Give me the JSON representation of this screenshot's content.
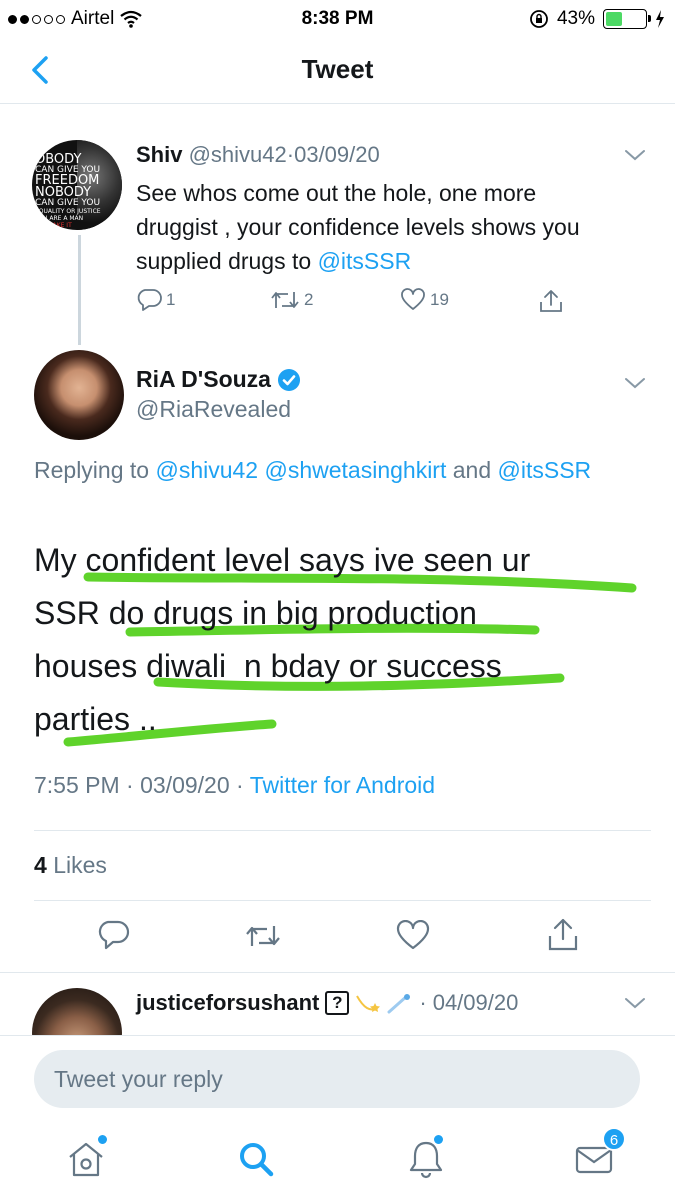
{
  "status_bar": {
    "carrier": "Airtel",
    "time": "8:38 PM",
    "battery_percent": "43%",
    "battery_level": 0.43,
    "signal_bars_filled": 2,
    "signal_bars_total": 5
  },
  "nav": {
    "title": "Tweet",
    "back_icon": "chevron-left-icon"
  },
  "parent_tweet": {
    "name": "Shiv",
    "handle": "@shivu42",
    "separator": "·",
    "date": "03/09/20",
    "text_plain": "See whos come out the hole, one more druggist , your confidence levels shows you supplied drugs to ",
    "mention": "@itsSSR",
    "replies": "1",
    "retweets": "2",
    "likes": "19",
    "avatar_lines": [
      "OBODY",
      "CAN GIVE YOU",
      "FREEDOM",
      "NOBODY",
      "CAN GIVE YOU",
      "EQUALITY OR JUSTICE",
      "YOU ARE A MAN",
      "YOU TAKE IT"
    ]
  },
  "main_tweet": {
    "name": "RiA D'Souza",
    "handle": "@RiaRevealed",
    "verified": true,
    "replying_label": "Replying to",
    "replying_mention_1": "@shivu42",
    "replying_mention_2": "@shwetasinghkirt",
    "replying_and": "and",
    "replying_mention_3": "@itsSSR",
    "text_line_1": "My confident level says ive seen ur",
    "text_line_2": "SSR do drugs in big production",
    "text_line_3": "houses diwali  n bday or success",
    "text_line_4": "parties ..",
    "time": "7:55 PM",
    "separator": "·",
    "date": "03/09/20",
    "source": "Twitter for Android",
    "likes_count": "4",
    "likes_label": "Likes",
    "highlight_color": "#5fd32b"
  },
  "next_tweet": {
    "name": "justiceforsushant",
    "emoji_box": "?",
    "separator": "·",
    "date": "04/09/20"
  },
  "reply_bar": {
    "placeholder": "Tweet your reply"
  },
  "tab_bar": {
    "items": [
      "home-icon",
      "search-icon",
      "notifications-icon",
      "messages-icon"
    ],
    "messages_badge": "6"
  },
  "colors": {
    "accent": "#1da1f2",
    "text": "#14171a",
    "secondary_text": "#657786",
    "divider": "#e1e8ed"
  }
}
